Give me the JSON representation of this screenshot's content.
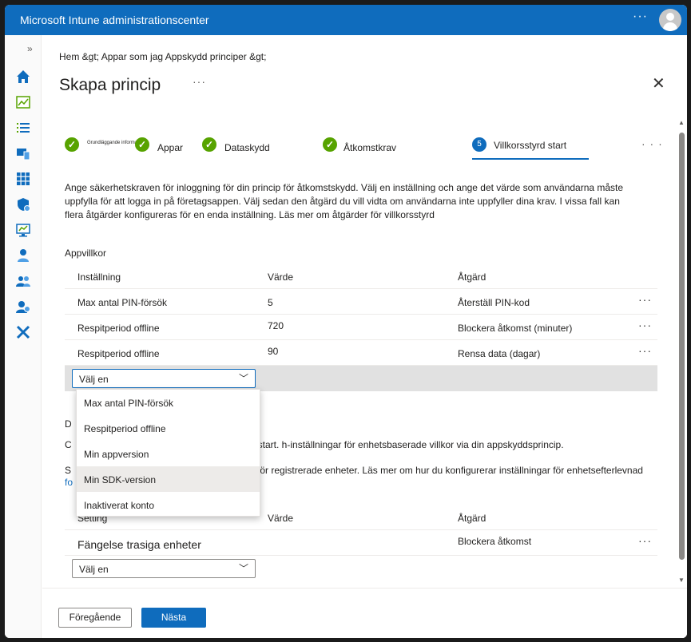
{
  "topbar": {
    "title": "Microsoft Intune administrationscenter",
    "more": "···"
  },
  "nav": {
    "expand": "»",
    "icons": [
      "home-icon",
      "dashboard-icon",
      "all-services-icon",
      "devices-icon",
      "apps-icon",
      "endpoint-security-icon",
      "reports-icon",
      "users-icon",
      "groups-icon",
      "tenant-admin-icon",
      "troubleshooting-icon"
    ]
  },
  "breadcrumb": "Hem &gt;   Appar som jag Appskydd principer &gt;",
  "page": {
    "title": "Skapa princip",
    "more": "···",
    "close": "✕"
  },
  "wizard": {
    "steps": [
      {
        "label": "Grundläggande information",
        "status": "done"
      },
      {
        "label": "Appar",
        "status": "done"
      },
      {
        "label": "Dataskydd",
        "status": "done"
      },
      {
        "label": "Åtkomstkrav",
        "status": "done"
      },
      {
        "number": "5",
        "label": "Villkorsstyrd start",
        "status": "active"
      }
    ],
    "more": "· · ·"
  },
  "description": "Ange säkerhetskraven för inloggning för din princip för åtkomstskydd. Välj en inställning och ange det värde som användarna måste uppfylla för att logga in på företagsappen. Välj sedan den åtgärd du vill vidta om användarna inte uppfyller dina krav. I vissa fall kan flera åtgärder konfigureras för en enda inställning. Läs mer om åtgärder för villkorsstyrd",
  "app_conditions": {
    "label": "Appvillkor",
    "headers": [
      "Inställning",
      "Värde",
      "Åtgärd"
    ],
    "rows": [
      {
        "setting": "Max antal PIN-försök",
        "value": "5",
        "action": "Återställ PIN-kod"
      },
      {
        "setting": "Respitperiod offline",
        "value": "720",
        "action": "Blockera åtkomst (minuter)"
      },
      {
        "setting": "Respitperiod offline",
        "value": "90",
        "action": "Rensa data (dagar)"
      }
    ],
    "select_value": "Välj en",
    "dropdown_options": [
      "Max antal PIN-försök",
      "Respitperiod offline",
      "Min appversion",
      "Min SDK-version",
      "Inaktiverat konto"
    ]
  },
  "device_conditions": {
    "head": "D",
    "desc1_prefix": "C",
    "desc1": "start. h-inställningar för enhetsbaserade villkor via din appskyddsprincip.",
    "desc2_prefix": "S",
    "desc2": "för registrerade enheter. Läs mer om hur du konfigurerar inställningar för enhetsefterlevnad",
    "desc2_link": "fo",
    "headers": [
      "Setting",
      "Värde",
      "Åtgärd"
    ],
    "rows": [
      {
        "setting": "Fängelse trasiga enheter",
        "value": "",
        "action": "Blockera åtkomst"
      }
    ],
    "select_value": "Välj en"
  },
  "row_more": "···",
  "footer": {
    "prev": "Föregående",
    "next": "Nästa"
  }
}
